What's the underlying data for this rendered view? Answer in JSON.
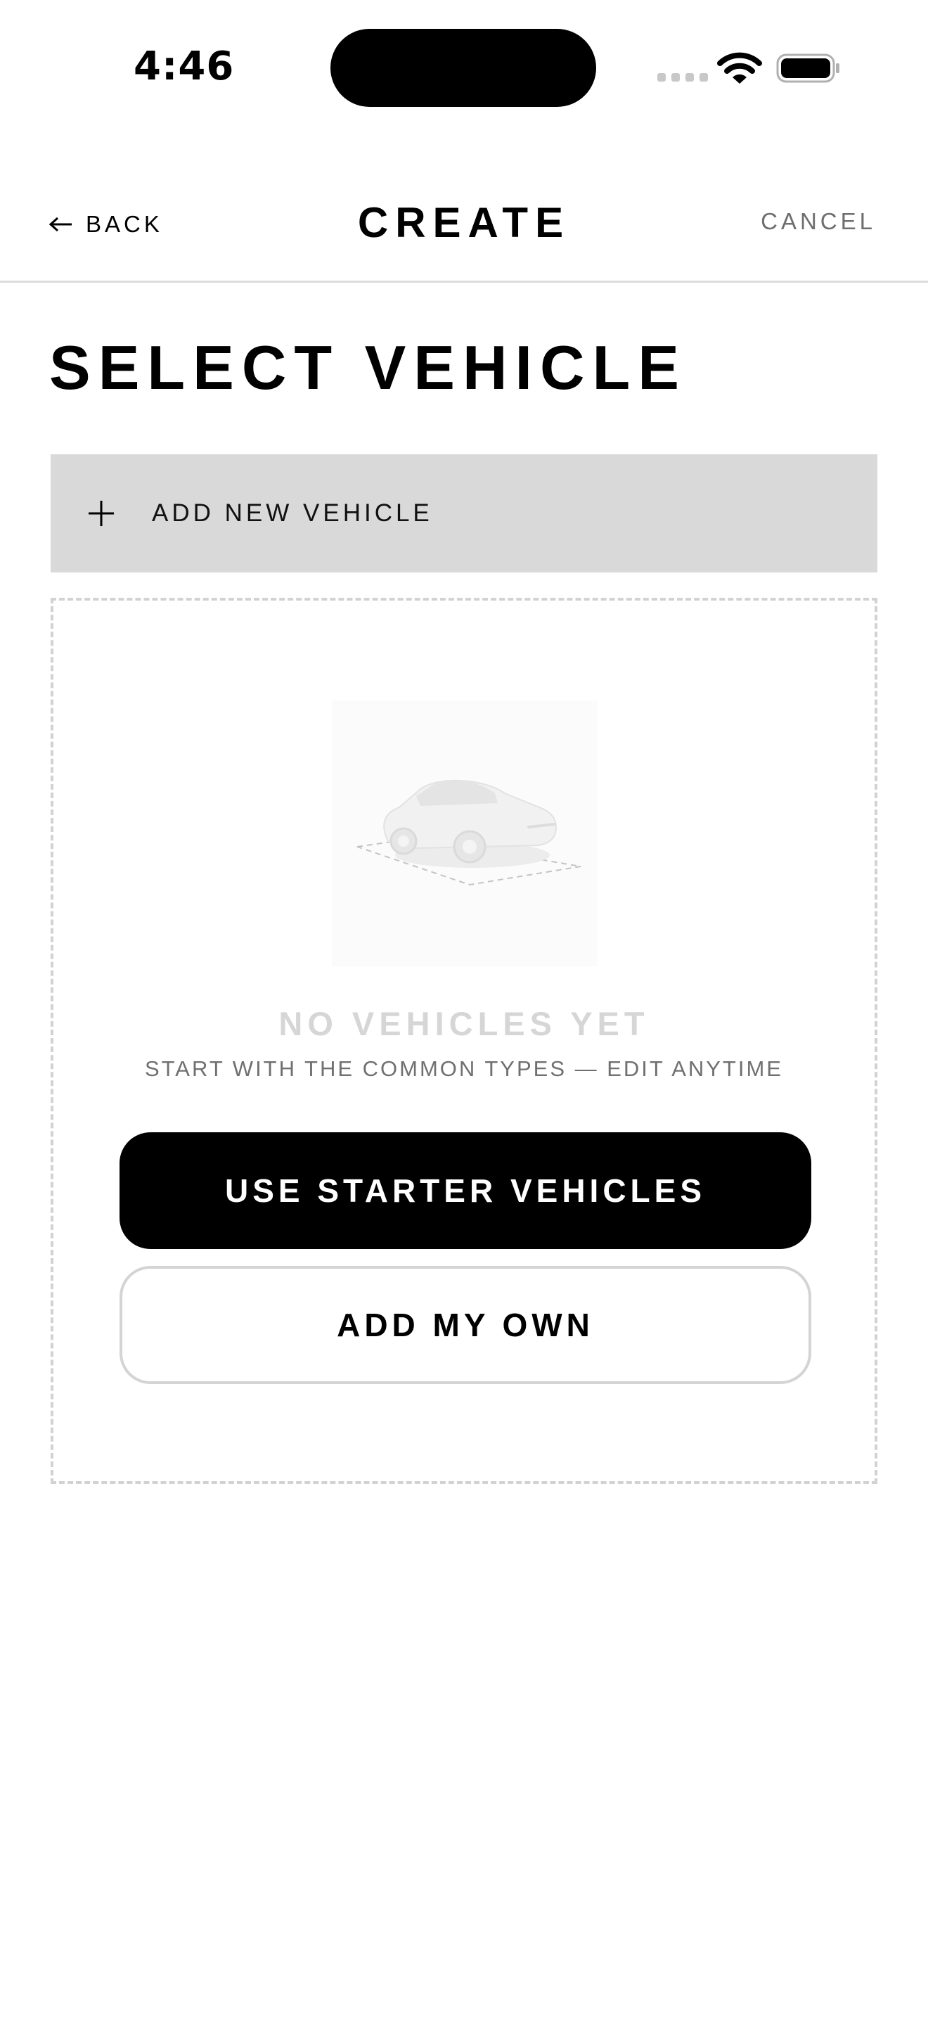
{
  "status_bar": {
    "time": "4:46"
  },
  "nav": {
    "back_label": "BACK",
    "title": "CREATE",
    "cancel_label": "CANCEL"
  },
  "page": {
    "title": "SELECT VEHICLE"
  },
  "add_vehicle": {
    "label": "ADD NEW VEHICLE",
    "icon": "plus-icon"
  },
  "empty_state": {
    "illustration": "car-icon",
    "title": "NO VEHICLES YET",
    "subtitle": "START WITH THE COMMON TYPES — EDIT ANYTIME",
    "primary_button": "USE STARTER VEHICLES",
    "secondary_button": "ADD MY OWN"
  },
  "colors": {
    "primary": "#000000",
    "add_row_background": "#d9d9d9",
    "muted_text": "#707070",
    "empty_title": "#d6d6d6",
    "border": "#d4d4d4"
  }
}
